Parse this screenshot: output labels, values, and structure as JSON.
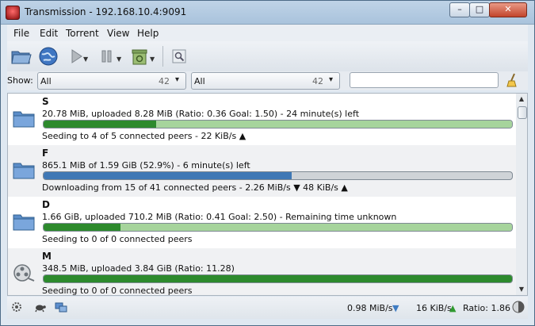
{
  "window": {
    "title": "Transmission - 192.168.10.4:9091",
    "min": "–",
    "max": "□",
    "close": "✕"
  },
  "menu": [
    "File",
    "Edit",
    "Torrent",
    "View",
    "Help"
  ],
  "filter": {
    "label": "Show:",
    "activity": {
      "value": "All",
      "count": "42"
    },
    "tracker": {
      "value": "All",
      "count": "42"
    },
    "search_placeholder": ""
  },
  "torrents": [
    {
      "name": "S",
      "progress": "20.78 MiB, uploaded 8.28 MiB (Ratio: 0.36 Goal: 1.50) - 24 minute(s) left",
      "status": "Seeding to 4 of 5 connected peers - 22 KiB/s ▲",
      "state": "seeding",
      "fraction": 0.24,
      "icon": "folder-icon"
    },
    {
      "name": "F",
      "progress": "865.1 MiB of 1.59 GiB (52.9%) - 6 minute(s) left",
      "status": "Downloading from 15 of 41 connected peers - 2.26 MiB/s ▼  48 KiB/s ▲",
      "state": "downloading",
      "fraction": 0.529,
      "icon": "folder-icon"
    },
    {
      "name": "D",
      "progress": "1.66 GiB, uploaded 710.2 MiB (Ratio: 0.41 Goal: 2.50) - Remaining time unknown",
      "status": "Seeding to 0 of 0 connected peers",
      "state": "seeding",
      "fraction": 0.164,
      "icon": "folder-icon"
    },
    {
      "name": "M",
      "progress": "348.5 MiB, uploaded 3.84 GiB (Ratio: 11.28)",
      "status": "Seeding to 0 of 0 connected peers",
      "state": "seeding",
      "fraction": 1.0,
      "icon": "film-reel-icon"
    }
  ],
  "statusbar": {
    "down": "0.98 MiB/s",
    "up": "16 KiB/s",
    "ratio": "Ratio: 1.86"
  },
  "colors": {
    "seed_fill": "#2d8a2d",
    "seed_bg": "#a6d49c",
    "download_fill": "#3f78b5",
    "download_bg": "#cfd3d7",
    "down_arrow": "#3e7cc2",
    "up_arrow": "#2f9a2f"
  }
}
